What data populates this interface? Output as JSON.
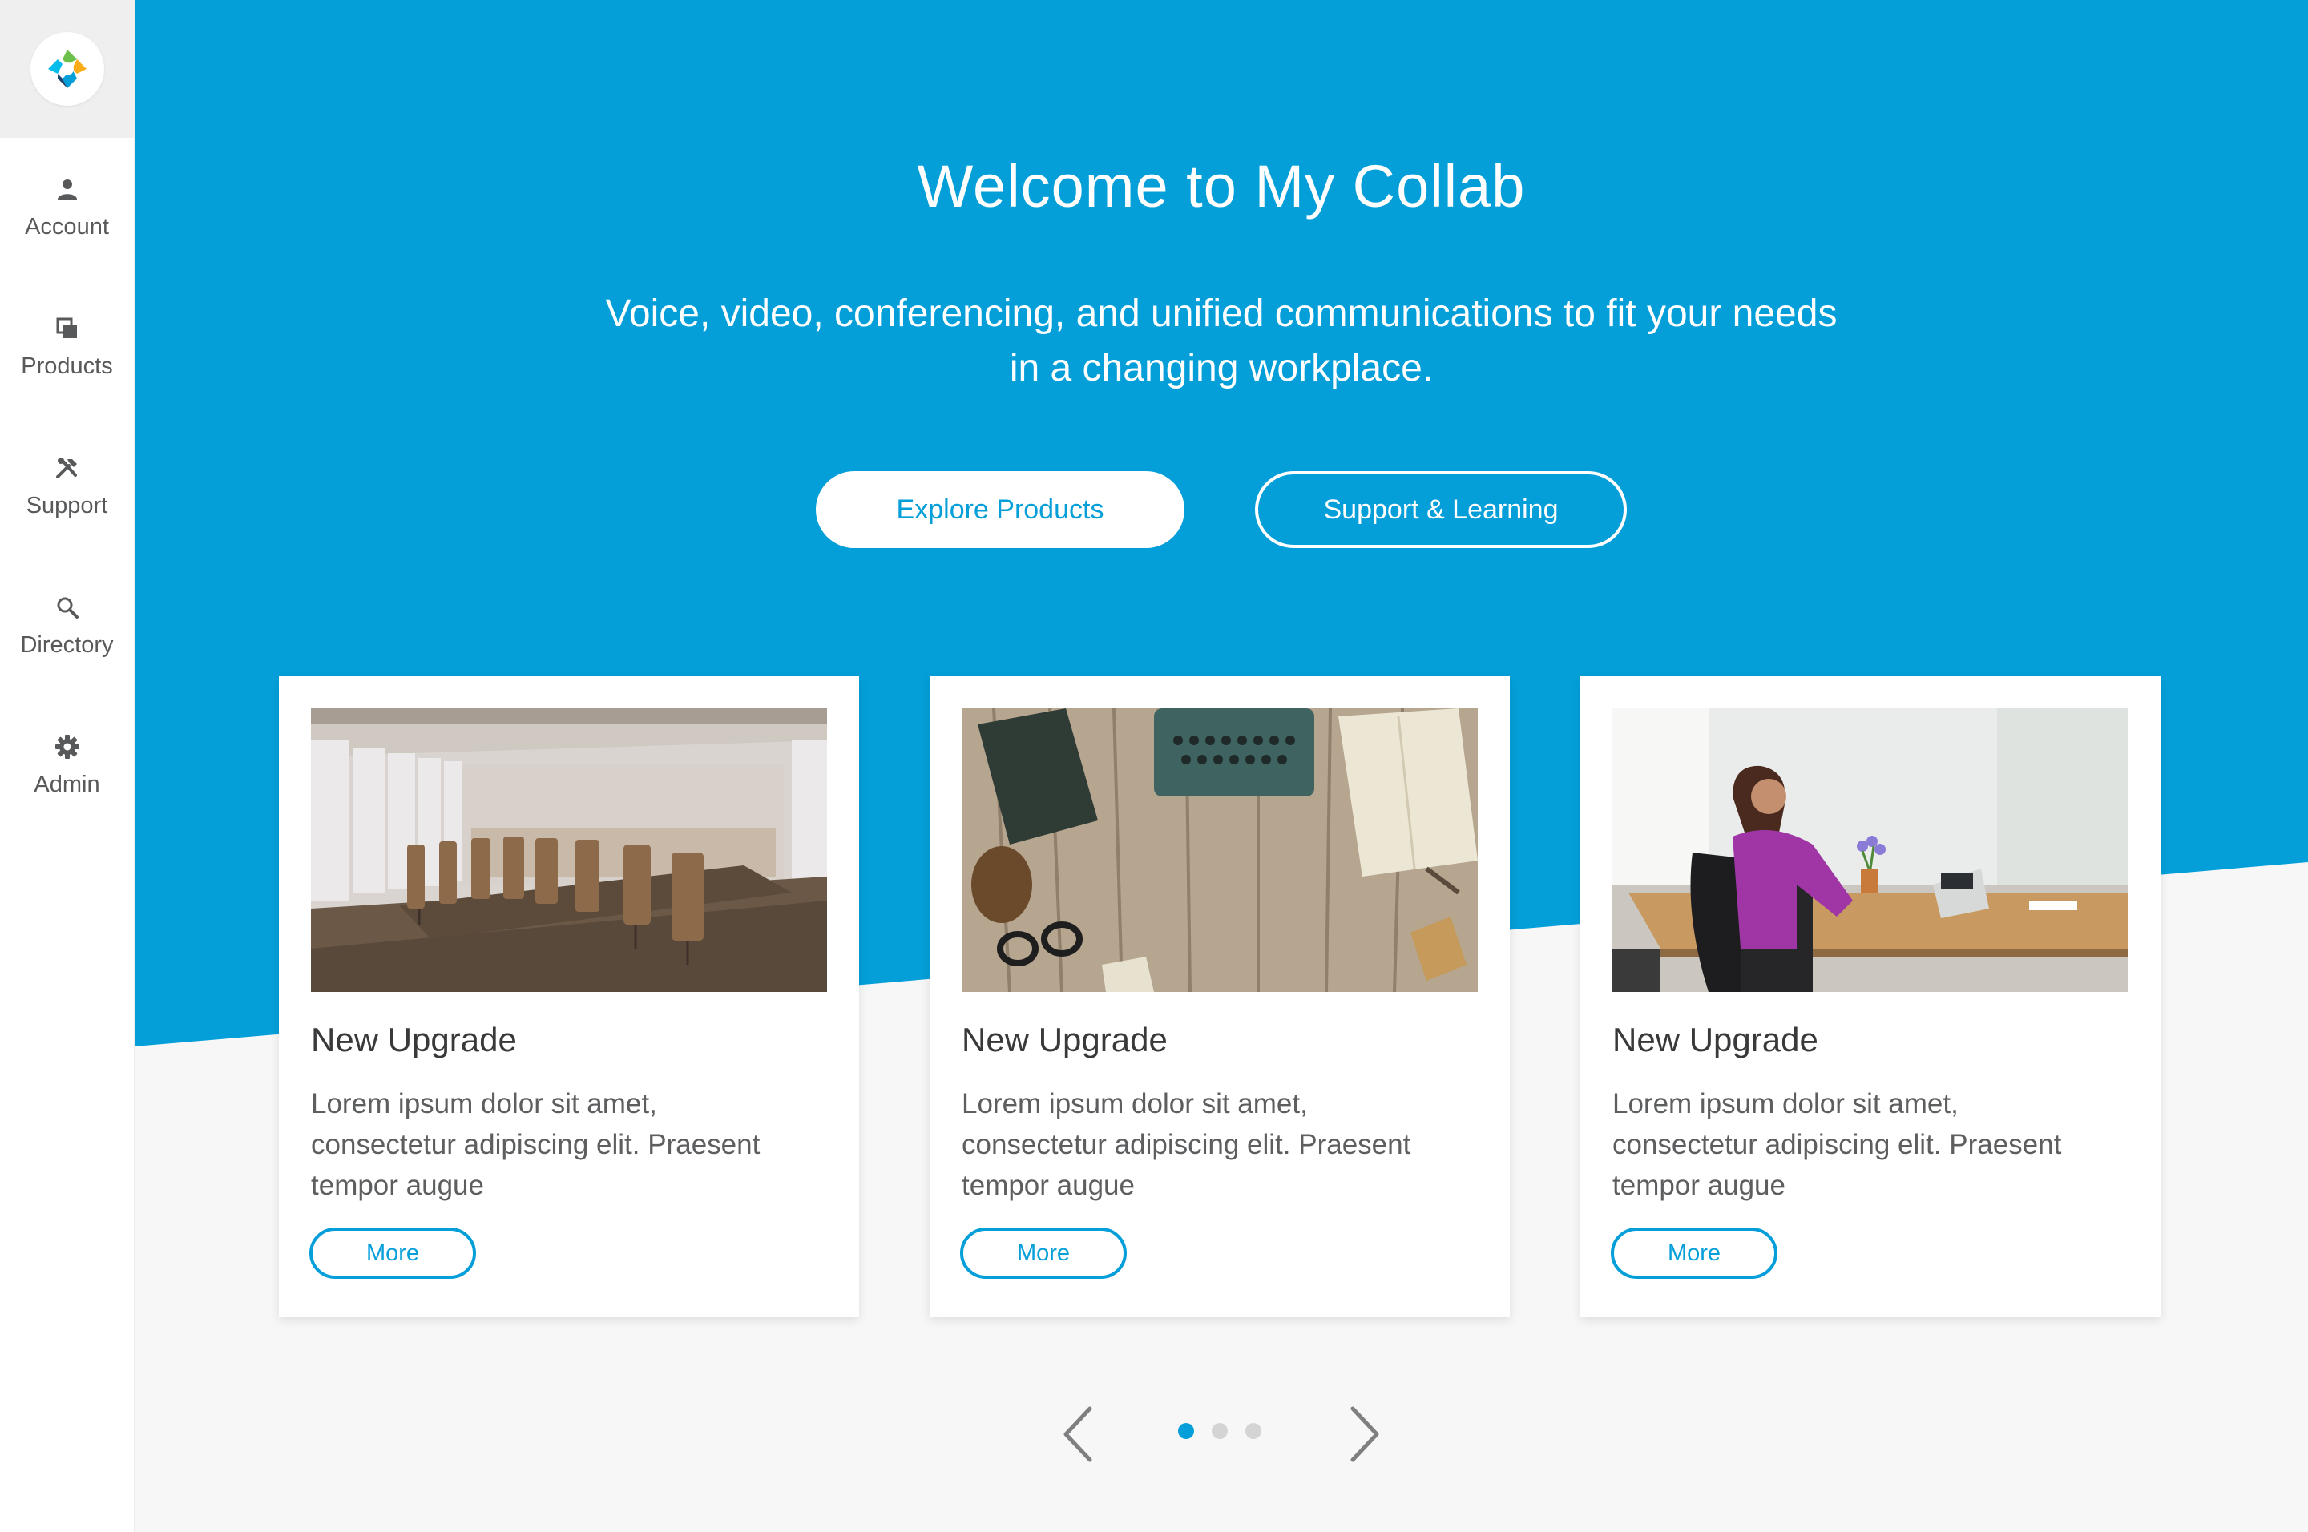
{
  "sidebar": {
    "logo": "my-collab-logo",
    "items": [
      {
        "label": "Account",
        "icon": "user-icon"
      },
      {
        "label": "Products",
        "icon": "products-icon"
      },
      {
        "label": "Support",
        "icon": "tools-icon"
      },
      {
        "label": "Directory",
        "icon": "search-icon"
      },
      {
        "label": "Admin",
        "icon": "gear-icon"
      }
    ]
  },
  "hero": {
    "title": "Welcome to My Collab",
    "subtitle_line1": "Voice, video, conferencing, and unified communications to fit your needs",
    "subtitle_line2": "in a changing workplace.",
    "primary_button": "Explore Products",
    "secondary_button": "Support & Learning"
  },
  "cards": [
    {
      "image": "conference-room-photo",
      "title": "New Upgrade",
      "text": "Lorem ipsum dolor sit amet, consectetur adipiscing elit. Praesent tempor augue",
      "button": "More"
    },
    {
      "image": "typewriter-desk-photo",
      "title": "New Upgrade",
      "text": "Lorem ipsum dolor sit amet, consectetur adipiscing elit. Praesent tempor augue",
      "button": "More"
    },
    {
      "image": "woman-at-desk-phone-photo",
      "title": "New Upgrade",
      "text": "Lorem ipsum dolor sit amet, consectetur adipiscing elit. Praesent tempor augue",
      "button": "More"
    }
  ],
  "carousel": {
    "prev_icon": "chevron-left-icon",
    "next_icon": "chevron-right-icon",
    "pages": 3,
    "active_page": 1
  },
  "colors": {
    "brand_blue": "#049fd9",
    "page_bg": "#f7f7f7",
    "sidebar_bg": "#ffffff",
    "dot_inactive": "#d4d4d4"
  }
}
